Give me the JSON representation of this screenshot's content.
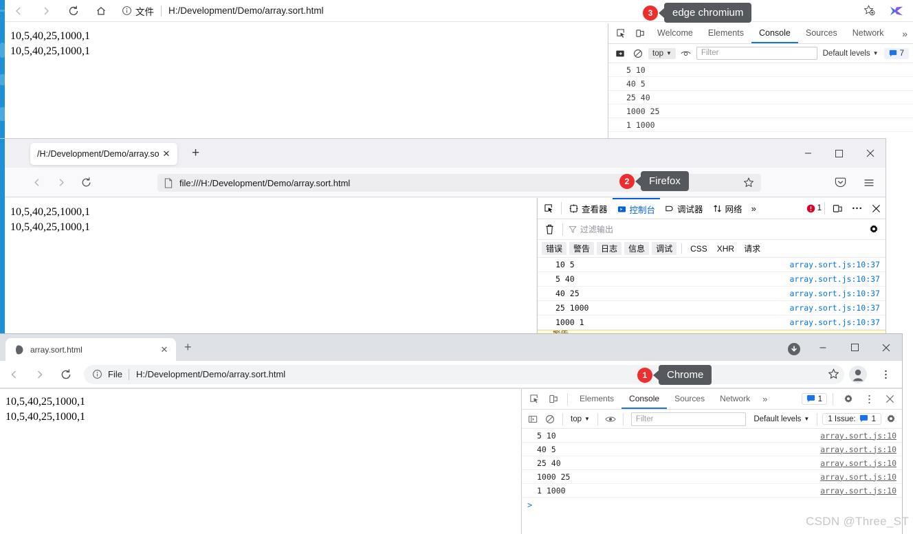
{
  "edge": {
    "name": "edge chromium",
    "toolbar": {
      "back_icon": "back-arrow-icon",
      "forward_icon": "forward-arrow-icon",
      "reload_icon": "reload-icon",
      "home_icon": "home-icon",
      "security_label": "文件",
      "url": "H:/Development/Demo/array.sort.html",
      "favorite_icon": "add-favorite-star-icon",
      "extension_icon": "extension-icon"
    },
    "page_lines": [
      "10,5,40,25,1000,1",
      "10,5,40,25,1000,1"
    ],
    "devtools": {
      "inspect_icon": "inspect-element-icon",
      "device_icon": "device-toolbar-icon",
      "tabs": [
        "Welcome",
        "Elements",
        "Console",
        "Sources",
        "Network"
      ],
      "active_tab": "Console",
      "more_tabs": "»",
      "sidebar_icon": "console-sidebar-icon",
      "clear_icon": "clear-console-icon",
      "context": "top",
      "eye_icon": "live-expression-icon",
      "filter_placeholder": "Filter",
      "levels": "Default levels",
      "issues_count": "7",
      "issues_icon": "issues-icon",
      "rows": [
        "5 10",
        "40 5",
        "25 40",
        "1000 25",
        "1 1000"
      ]
    }
  },
  "firefox": {
    "name": "Firefox",
    "tab": {
      "title": "/H:/Development/Demo/array.sort.l",
      "close_icon": "close-tab-icon"
    },
    "newtab_label": "+",
    "window_controls": {
      "minimize": "–",
      "maximize": "□",
      "close": "✕"
    },
    "toolbar": {
      "back_icon": "back-arrow-icon",
      "forward_icon": "forward-arrow-icon",
      "reload_icon": "reload-icon",
      "page_icon": "document-icon",
      "url": "file:///H:/Development/Demo/array.sort.html",
      "star_icon": "bookmark-star-icon",
      "pocket_icon": "pocket-icon",
      "menu_icon": "hamburger-menu-icon"
    },
    "page_lines": [
      "10,5,40,25,1000,1",
      "10,5,40,25,1000,1"
    ],
    "devtools": {
      "picker_icon": "element-picker-icon",
      "tabs": [
        "查看器",
        "控制台",
        "调试器",
        "网络"
      ],
      "active_tab": "控制台",
      "more_tabs": "»",
      "error_count": "1",
      "error_icon": "error-badge-icon",
      "responsive_icon": "responsive-design-mode-icon",
      "meatball_icon": "devtools-options-icon",
      "close_icon": "close-devtools-icon",
      "trash_icon": "clear-console-icon",
      "filter_icon": "filter-funnel-icon",
      "filter_placeholder": "过滤输出",
      "settings_icon": "console-settings-gear-icon",
      "levels": [
        "错误",
        "警告",
        "日志",
        "信息",
        "调试"
      ],
      "request_filters": [
        "CSS",
        "XHR",
        "请求"
      ],
      "rows": [
        {
          "text": "10 5",
          "source": "array.sort.js:10:37"
        },
        {
          "text": "5 40",
          "source": "array.sort.js:10:37"
        },
        {
          "text": "40 25",
          "source": "array.sort.js:10:37"
        },
        {
          "text": "25 1000",
          "source": "array.sort.js:10:37"
        },
        {
          "text": "1000 1",
          "source": "array.sort.js:10:37"
        }
      ],
      "warning_text": "警告"
    }
  },
  "chrome": {
    "name": "Chrome",
    "tab": {
      "title": "array.sort.html",
      "favicon": "generic-page-favicon",
      "close_icon": "close-tab-icon"
    },
    "newtab_label": "+",
    "download_icon": "download-icon",
    "window_controls": {
      "minimize": "–",
      "maximize": "□",
      "close": "✕"
    },
    "toolbar": {
      "back_icon": "back-arrow-icon",
      "forward_icon": "forward-arrow-icon",
      "reload_icon": "reload-icon",
      "info_icon": "page-info-icon",
      "scheme_label": "File",
      "url": "H:/Development/Demo/array.sort.html",
      "star_icon": "bookmark-star-icon",
      "profile_icon": "profile-avatar-icon",
      "menu_icon": "three-dot-menu-icon"
    },
    "page_lines": [
      "10,5,40,25,1000,1",
      "10,5,40,25,1000,1"
    ],
    "devtools": {
      "inspect_icon": "inspect-element-icon",
      "device_icon": "device-toolbar-icon",
      "tabs": [
        "Elements",
        "Console",
        "Sources",
        "Network"
      ],
      "active_tab": "Console",
      "more_tabs": "»",
      "issue_badge_count": "1",
      "issue_badge_icon": "issues-icon",
      "settings_icon": "devtools-settings-gear-icon",
      "meatball_icon": "devtools-more-options-icon",
      "close_icon": "close-devtools-icon",
      "execute_icon": "console-sidebar-icon",
      "clear_icon": "clear-console-icon",
      "context": "top",
      "eye_icon": "live-expression-icon",
      "filter_placeholder": "Filter",
      "levels": "Default levels",
      "issue_label": "1 Issue:",
      "issue_count": "1",
      "console_settings_icon": "console-settings-gear-icon",
      "rows": [
        {
          "text": "5 10",
          "source": "array.sort.js:10"
        },
        {
          "text": "40 5",
          "source": "array.sort.js:10"
        },
        {
          "text": "25 40",
          "source": "array.sort.js:10"
        },
        {
          "text": "1000 25",
          "source": "array.sort.js:10"
        },
        {
          "text": "1 1000",
          "source": "array.sort.js:10"
        }
      ],
      "prompt": ">"
    }
  },
  "callouts": [
    {
      "number": "3",
      "label": "edge chromium"
    },
    {
      "number": "2",
      "label": "Firefox"
    },
    {
      "number": "1",
      "label": "Chrome"
    }
  ],
  "watermark": "CSDN @Three_ST",
  "colors": {
    "edge_accent": "#0f7bd4",
    "firefox_accent": "#0060df",
    "chrome_accent": "#1a73e8",
    "callout_badge": "#ee2d2d",
    "callout_bubble": "#55585c",
    "taskbar_blue": "#1e90d8"
  }
}
